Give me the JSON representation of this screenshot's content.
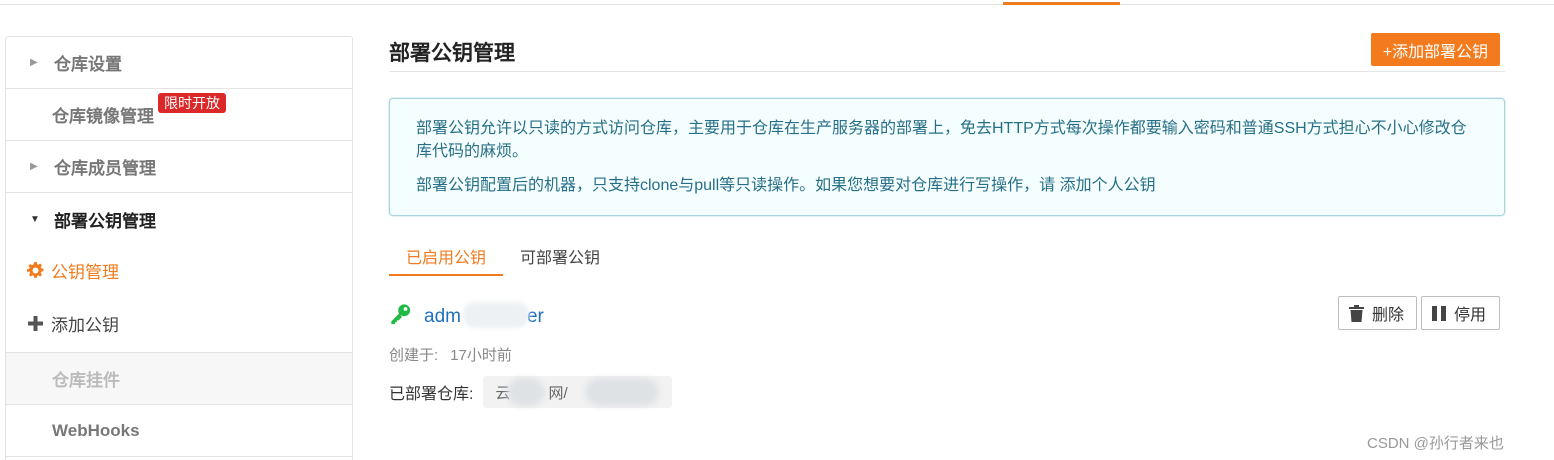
{
  "sidebar": {
    "repo_settings": "仓库设置",
    "mirror_management": "仓库镜像管理",
    "mirror_badge": "限时开放",
    "member_management": "仓库成员管理",
    "deploy_key_management": "部署公钥管理",
    "key_management": "公钥管理",
    "add_key": "添加公钥",
    "repo_plugins": "仓库挂件",
    "webhooks": "WebHooks"
  },
  "main": {
    "title": "部署公钥管理",
    "add_button": "+添加部署公钥",
    "info_line1": "部署公钥允许以只读的方式访问仓库，主要用于仓库在生产服务器的部署上，免去HTTP方式每次操作都要输入密码和普通SSH方式担心不小心修改仓库代码的麻烦。",
    "info_line2": "部署公钥配置后的机器，只支持clone与pull等只读操作。如果您想要对仓库进行写操作，请 添加个人公钥",
    "tabs": [
      "已启用公钥",
      "可部署公钥"
    ],
    "key": {
      "name_start": "adm",
      "name_end": "er",
      "created_label": "创建于:",
      "created_value": "17小时前",
      "deployed_label": "已部署仓库:",
      "repo_start": "云",
      "repo_mid": "网/",
      "delete_button": "删除",
      "disable_button": "停用"
    }
  },
  "watermark": "CSDN @孙行者来也",
  "colors": {
    "accent": "#f37b1d",
    "link": "#1e70bf",
    "info_text": "#276f86",
    "badge": "#db2828",
    "key_icon": "#21ba45"
  }
}
